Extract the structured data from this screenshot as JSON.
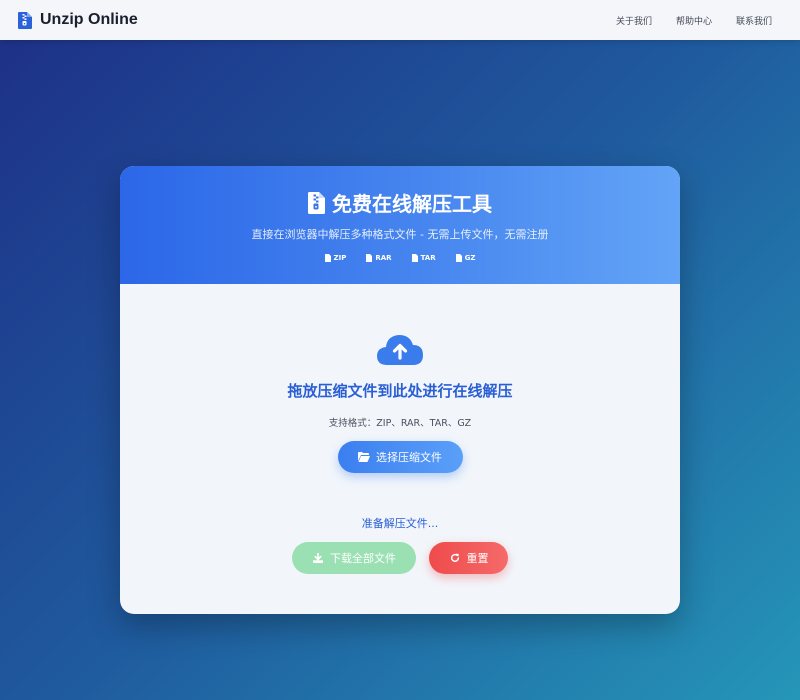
{
  "navbar": {
    "brand": "Unzip Online",
    "brand_icon": "zip-file-icon",
    "links": [
      {
        "label": "关于我们"
      },
      {
        "label": "帮助中心"
      },
      {
        "label": "联系我们"
      }
    ]
  },
  "header": {
    "title": "免费在线解压工具",
    "title_icon": "zip-file-icon",
    "subtitle": "直接在浏览器中解压多种格式文件 - 无需上传文件，无需注册",
    "formats": [
      {
        "label": "ZIP",
        "icon": "file-icon"
      },
      {
        "label": "RAR",
        "icon": "file-icon"
      },
      {
        "label": "TAR",
        "icon": "file-icon"
      },
      {
        "label": "GZ",
        "icon": "file-icon"
      }
    ]
  },
  "dropzone": {
    "icon": "cloud-upload-icon",
    "title": "拖放压缩文件到此处进行在线解压",
    "supported": "支持格式：ZIP、RAR、TAR、GZ",
    "select_button": "选择压缩文件",
    "select_icon": "folder-open-icon"
  },
  "status": {
    "text": "准备解压文件...",
    "download_button": "下载全部文件",
    "download_icon": "download-icon",
    "reset_button": "重置",
    "reset_icon": "refresh-icon"
  },
  "colors": {
    "accent": "#2a5ed4",
    "header_start": "#2b67e8",
    "header_end": "#63a4f7",
    "download_disabled": "#9be0b2",
    "reset": "#ef4b4b"
  }
}
